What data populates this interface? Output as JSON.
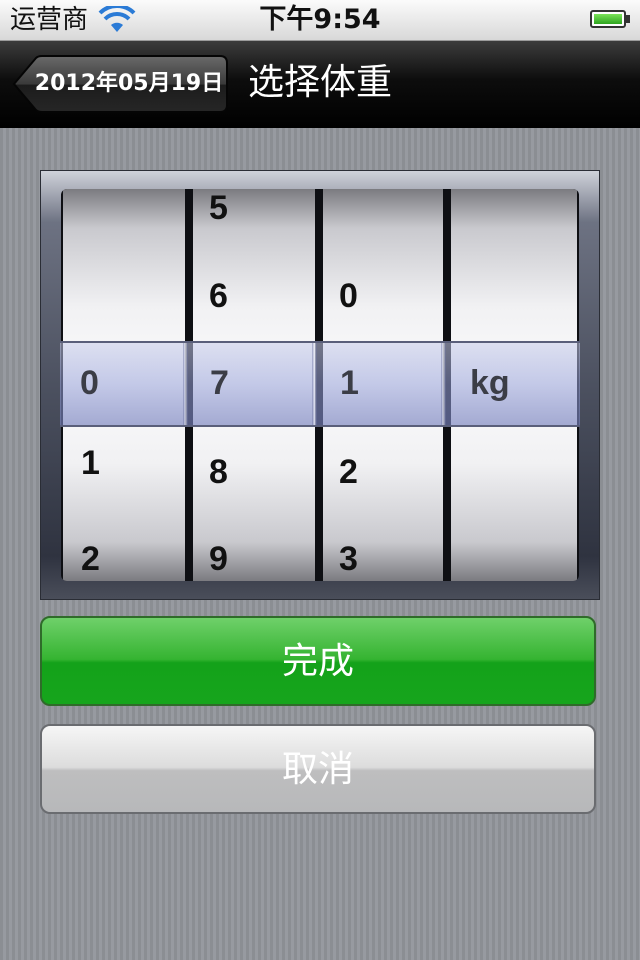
{
  "status_bar": {
    "carrier": "运营商",
    "time": "下午9:54",
    "wifi_icon": "wifi-icon",
    "battery_icon": "battery-icon"
  },
  "nav_bar": {
    "back_label": "2012年05月19日",
    "title": "选择体重"
  },
  "picker": {
    "columns": [
      {
        "name": "hundreds",
        "visible": [
          "",
          "",
          "",
          "1",
          "2"
        ],
        "selected": "0"
      },
      {
        "name": "tens",
        "visible": [
          "5",
          "6",
          "",
          "8",
          "9"
        ],
        "selected": "7"
      },
      {
        "name": "ones",
        "visible": [
          "",
          "0",
          "",
          "2",
          "3"
        ],
        "selected": "1"
      },
      {
        "name": "unit",
        "visible": [
          "",
          "",
          "",
          "",
          ""
        ],
        "selected": "kg"
      }
    ]
  },
  "buttons": {
    "done_label": "完成",
    "cancel_label": "取消",
    "done_color": "#14a21a",
    "cancel_color": "#bebebf"
  }
}
